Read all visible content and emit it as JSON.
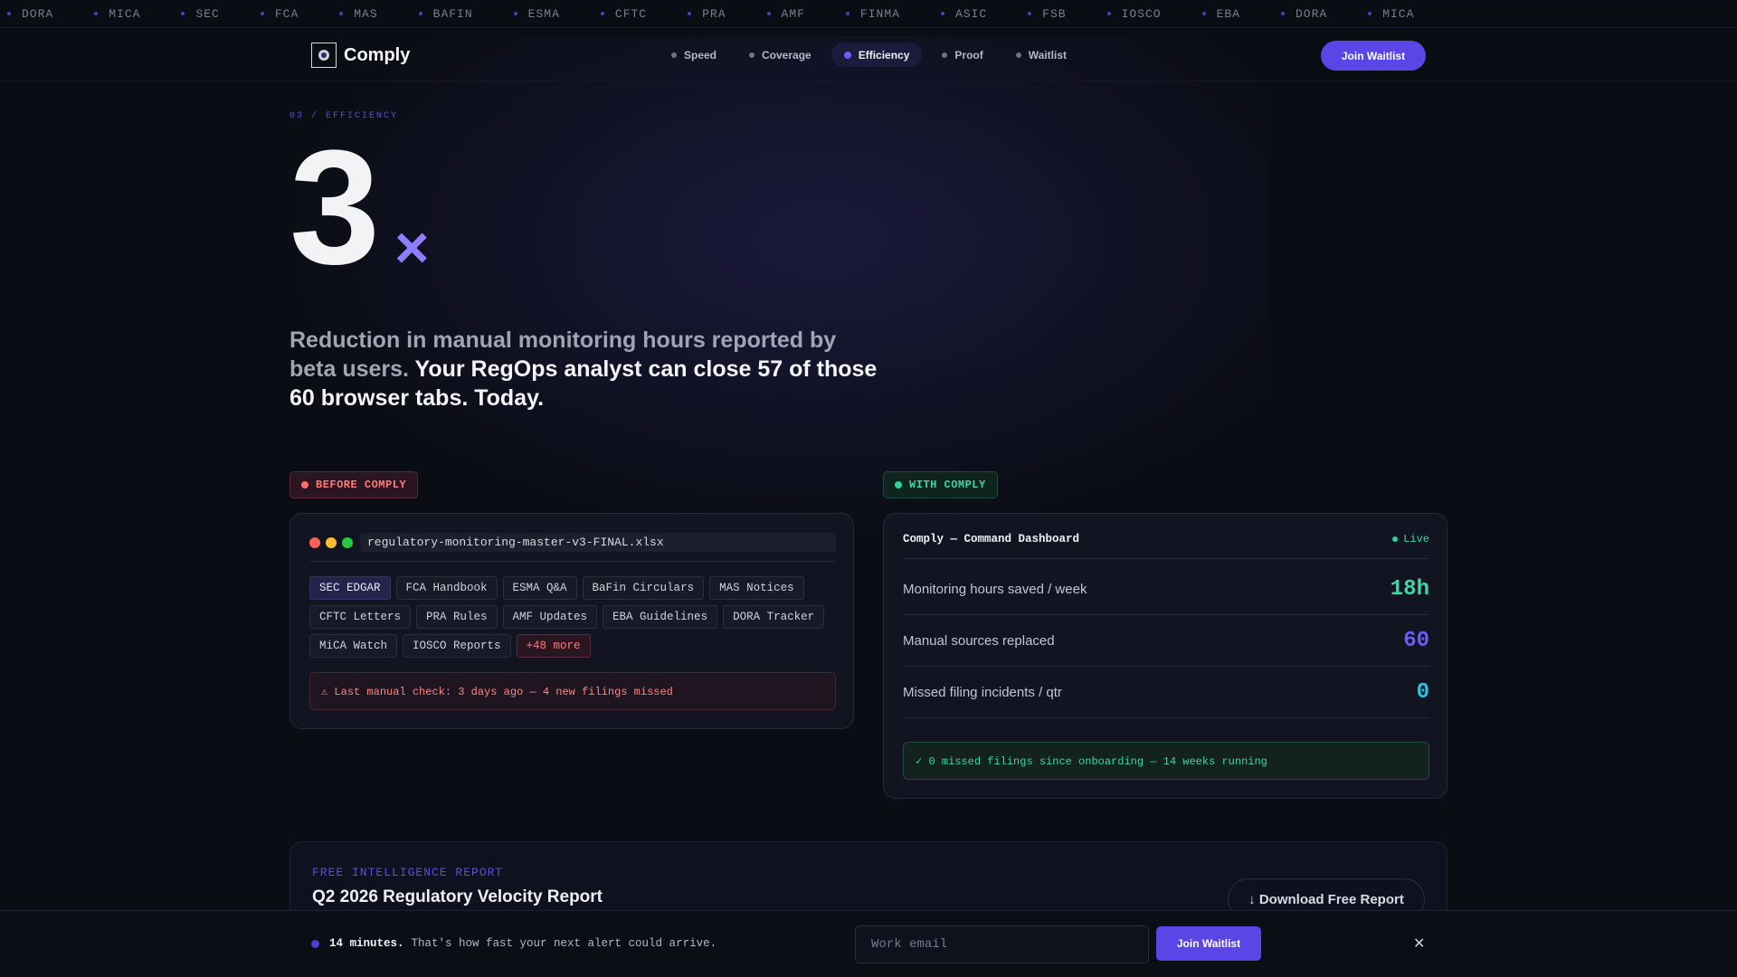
{
  "ticker": [
    "DORA",
    "MICA",
    "SEC",
    "FCA",
    "MAS",
    "BAFIN",
    "ESMA",
    "CFTC",
    "PRA",
    "AMF",
    "FINMA",
    "ASIC",
    "FSB",
    "IOSCO",
    "EBA",
    "DORA",
    "MICA"
  ],
  "nav": {
    "brand": "Comply",
    "links": [
      "Speed",
      "Coverage",
      "Efficiency",
      "Proof",
      "Waitlist"
    ],
    "active": "Efficiency",
    "cta": "Join Waitlist"
  },
  "hero": {
    "eyebrow": "03 / EFFICIENCY",
    "number": "3",
    "suffix": "×",
    "lede_muted": "Reduction in manual monitoring hours reported by beta users.",
    "lede_strong": "Your RegOps analyst can close 57 of those 60 browser tabs. Today."
  },
  "before": {
    "tag": "BEFORE COMPLY",
    "filename": "regulatory-monitoring-master-v3-FINAL.xlsx",
    "chips": [
      "SEC EDGAR",
      "FCA Handbook",
      "ESMA Q&A",
      "BaFin Circulars",
      "MAS Notices",
      "CFTC Letters",
      "PRA Rules",
      "AMF Updates",
      "EBA Guidelines",
      "DORA Tracker",
      "MiCA Watch",
      "IOSCO Reports"
    ],
    "more": "+48 more",
    "warning": "⚠ Last manual check: 3 days ago — 4 new filings missed"
  },
  "after": {
    "tag": "WITH COMPLY",
    "title": "Comply — Command Dashboard",
    "status": "Live",
    "metrics": [
      {
        "label": "Monitoring hours saved / week",
        "value": "18h",
        "color": "#3fd6a3"
      },
      {
        "label": "Manual sources replaced",
        "value": "60",
        "color": "#6a5cff"
      },
      {
        "label": "Missed filing incidents / qtr",
        "value": "0",
        "color": "#22c8e0"
      }
    ],
    "ok": "✓ 0 missed filings since onboarding — 14 weeks running"
  },
  "report": {
    "eyebrow": "FREE INTELLIGENCE REPORT",
    "title": "Q2 2026 Regulatory Velocity Report",
    "cta": "↓ Download Free Report"
  },
  "bar": {
    "strong": "14 minutes.",
    "text": "That's how fast your next alert could arrive.",
    "placeholder": "Work email",
    "cta": "Join Waitlist",
    "close": "✕"
  },
  "colors": {
    "accent": "#5a45e6",
    "danger": "#ff6b6b",
    "success": "#2fd39a"
  }
}
